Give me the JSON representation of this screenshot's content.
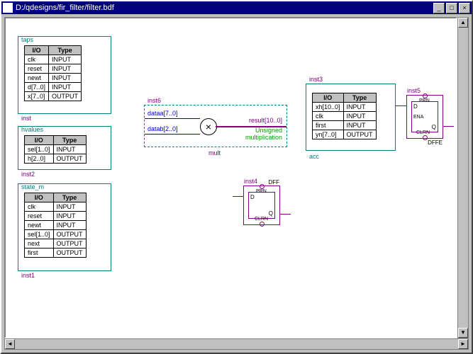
{
  "window": {
    "title": "D:/qdesigns/fir_filter/filter.bdf",
    "min_glyph": "_",
    "max_glyph": "□",
    "close_glyph": "×",
    "scroll_left": "◄",
    "scroll_right": "►",
    "scroll_up": "▲",
    "scroll_down": "▼"
  },
  "header": {
    "io": "I/O",
    "type": "Type"
  },
  "io_value": {
    "input": "INPUT",
    "output": "OUTPUT"
  },
  "blocks": {
    "taps": {
      "title": "taps",
      "inst": "inst",
      "rows": [
        {
          "io": "clk",
          "key": "input"
        },
        {
          "io": "reset",
          "key": "input"
        },
        {
          "io": "newt",
          "key": "input"
        },
        {
          "io": "d[7..0]",
          "key": "input"
        },
        {
          "io": "x[7..0]",
          "key": "output"
        }
      ]
    },
    "hvalues": {
      "title": "hvalues",
      "inst": "inst2",
      "rows": [
        {
          "io": "sel[1..0]",
          "key": "input"
        },
        {
          "io": "h[2..0]",
          "key": "output"
        }
      ]
    },
    "state_m": {
      "title": "state_m",
      "inst": "inst1",
      "rows": [
        {
          "io": "clk",
          "key": "input"
        },
        {
          "io": "reset",
          "key": "input"
        },
        {
          "io": "newt",
          "key": "input"
        },
        {
          "io": "sel[1..0]",
          "key": "output"
        },
        {
          "io": "next",
          "key": "output"
        },
        {
          "io": "first",
          "key": "output"
        }
      ]
    },
    "mult": {
      "title": "mult",
      "inst": "inst6",
      "dataa": "dataa[7..0]",
      "datab": "datab[2..0]",
      "result": "result[10..0]",
      "op1": "Unsigned",
      "op2": "multiplication",
      "symbol": "×"
    },
    "acc": {
      "title": "acc",
      "inst": "inst3",
      "rows": [
        {
          "io": "xh[10..0]",
          "key": "input"
        },
        {
          "io": "clk",
          "key": "input"
        },
        {
          "io": "first",
          "key": "input"
        },
        {
          "io": "yn[7..0]",
          "key": "output"
        }
      ]
    },
    "dff": {
      "title": "DFF",
      "inst": "inst4",
      "d": "D",
      "q": "Q",
      "prn": "PRN",
      "clrn": "CLRN"
    },
    "dffe": {
      "title": "DFFE",
      "inst": "inst5",
      "d": "D",
      "q": "Q",
      "prn": "PRN",
      "clrn": "CLRN",
      "ena": "ENA"
    }
  }
}
